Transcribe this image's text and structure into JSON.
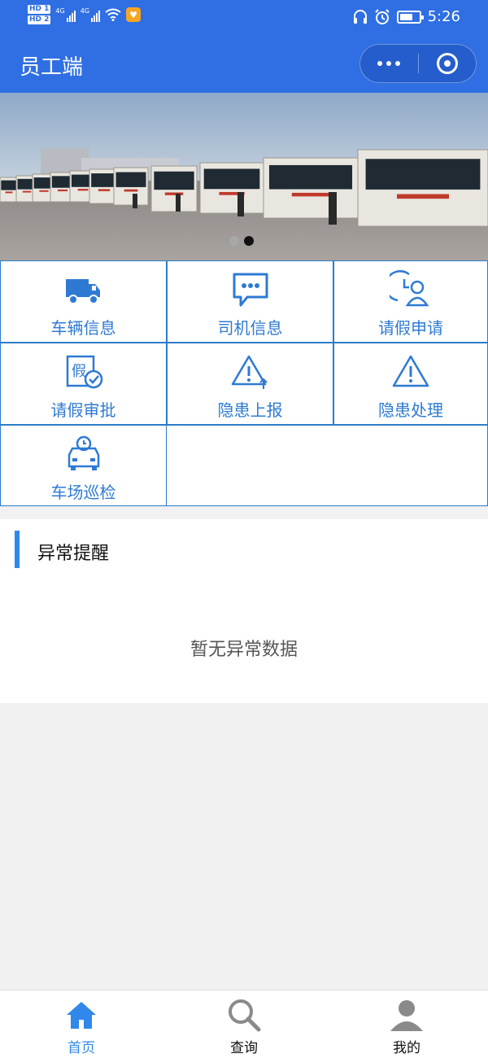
{
  "status_bar": {
    "hd1": "HD 1",
    "hd2": "HD 2",
    "net1": "4G",
    "net2": "4G",
    "time": "5:26",
    "battery_level": 0.7,
    "icons": [
      "signal-icon",
      "wifi-icon",
      "app-badge-icon",
      "headphones-icon",
      "alarm-icon",
      "battery-icon"
    ]
  },
  "nav": {
    "title": "员工端",
    "capsule_icons": [
      "more-icon",
      "close-target-icon"
    ],
    "bg_color": "#2f6fe3"
  },
  "banner": {
    "slide_count": 2,
    "active_index": 1
  },
  "menu": [
    {
      "label": "车辆信息",
      "icon": "truck-icon"
    },
    {
      "label": "司机信息",
      "icon": "chat-bubble-icon"
    },
    {
      "label": "请假申请",
      "icon": "clock-person-icon"
    },
    {
      "label": "请假审批",
      "icon": "leave-approval-icon"
    },
    {
      "label": "隐患上报",
      "icon": "warning-upload-icon"
    },
    {
      "label": "隐患处理",
      "icon": "warning-icon"
    },
    {
      "label": "车场巡检",
      "icon": "car-inspection-icon"
    }
  ],
  "alerts": {
    "title": "异常提醒",
    "empty_text": "暂无异常数据"
  },
  "tabbar": {
    "items": [
      {
        "label": "首页",
        "icon": "home-icon",
        "active": true
      },
      {
        "label": "查询",
        "icon": "search-icon",
        "active": false
      },
      {
        "label": "我的",
        "icon": "user-icon",
        "active": false
      }
    ],
    "active_color": "#2f88ea",
    "inactive_color": "#8a8a8a"
  },
  "colors": {
    "accent": "#2f88ea",
    "grid_border": "#2d7bc8",
    "menu_text": "#2e7ad3"
  }
}
